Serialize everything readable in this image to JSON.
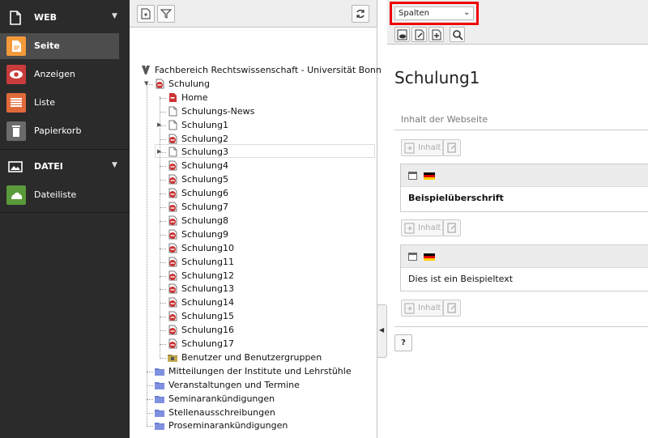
{
  "module_menu": {
    "groups": [
      {
        "label": "WEB",
        "icon": "document-icon"
      },
      {
        "label": "DATEI",
        "icon": "image-icon"
      }
    ],
    "items": [
      {
        "label": "Seite",
        "icon": "page-module-icon",
        "color": "#f39a3a",
        "active": true
      },
      {
        "label": "Anzeigen",
        "icon": "eye-icon",
        "color": "#c83c3c"
      },
      {
        "label": "Liste",
        "icon": "list-icon",
        "color": "#e06a3a"
      },
      {
        "label": "Papierkorb",
        "icon": "trash-icon",
        "color": "#6b6b6b"
      },
      {
        "label": "Dateiliste",
        "icon": "filelist-icon",
        "color": "#5a9a3a"
      }
    ]
  },
  "tree": {
    "root": "Fachbereich Rechtswissenschaft - Universität Bonn",
    "nodes": [
      "Schulung",
      "Home",
      "Schulungs-News",
      "Schulung1",
      "Schulung2",
      "Schulung3",
      "Schulung4",
      "Schulung5",
      "Schulung6",
      "Schulung7",
      "Schulung8",
      "Schulung9",
      "Schulung10",
      "Schulung11",
      "Schulung12",
      "Schulung13",
      "Schulung14",
      "Schulung15",
      "Schulung16",
      "Schulung17",
      "Benutzer und Benutzergruppen",
      "Mitteilungen der Institute und Lehrstühle",
      "Veranstaltungen und Termine",
      "Seminarankündigungen",
      "Stellenausschreibungen",
      "Proseminarankündigungen"
    ],
    "selected": "Schulung1"
  },
  "content": {
    "view_select": "Spalten",
    "page_title": "Schulung1",
    "column_label": "Inhalt der Webseite",
    "new_content_label": "Inhalt",
    "elements": [
      {
        "text": "Beispielüberschrift"
      },
      {
        "text": "Dies ist ein Beispieltext"
      }
    ],
    "help_label": "?"
  },
  "colors": {
    "highlight": "#e00000",
    "module_bg": "#2b2b2b"
  }
}
